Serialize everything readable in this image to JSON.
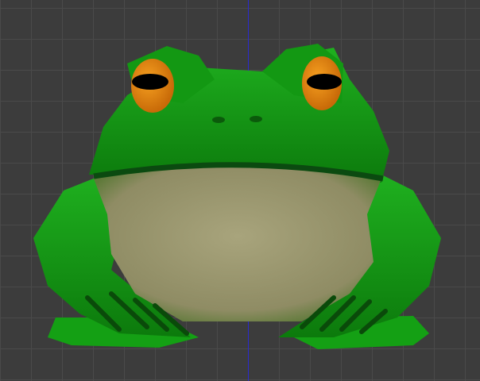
{
  "viewport": {
    "background_color": "#3c3c3c",
    "grid_color": "#4a4a4a",
    "axis_color": "#2a2ad0"
  },
  "model": {
    "skin_color": "#1a9a1a",
    "belly_color": "#9e9a72",
    "eye_color": "#e8860e",
    "pupil_color": "#000000"
  }
}
